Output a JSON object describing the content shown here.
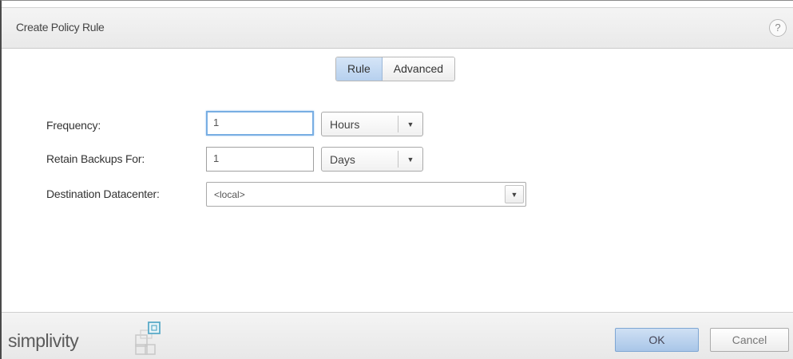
{
  "dialog": {
    "title": "Create Policy Rule",
    "help_label": "?"
  },
  "tabs": [
    {
      "label": "Rule",
      "active": true
    },
    {
      "label": "Advanced",
      "active": false
    }
  ],
  "form": {
    "frequency": {
      "label": "Frequency:",
      "value": "1",
      "unit": "Hours"
    },
    "retain": {
      "label": "Retain Backups For:",
      "value": "1",
      "unit": "Days"
    },
    "destination": {
      "label": "Destination Datacenter:",
      "value": "<local>"
    },
    "dropdown_arrow": "▼"
  },
  "footer": {
    "logo_text": "simplivity",
    "ok_label": "OK",
    "cancel_label": "Cancel"
  },
  "colors": {
    "accent": "#b6d0ee",
    "focus_border": "#78aee3",
    "logo_mark": "#6ab0c8"
  }
}
